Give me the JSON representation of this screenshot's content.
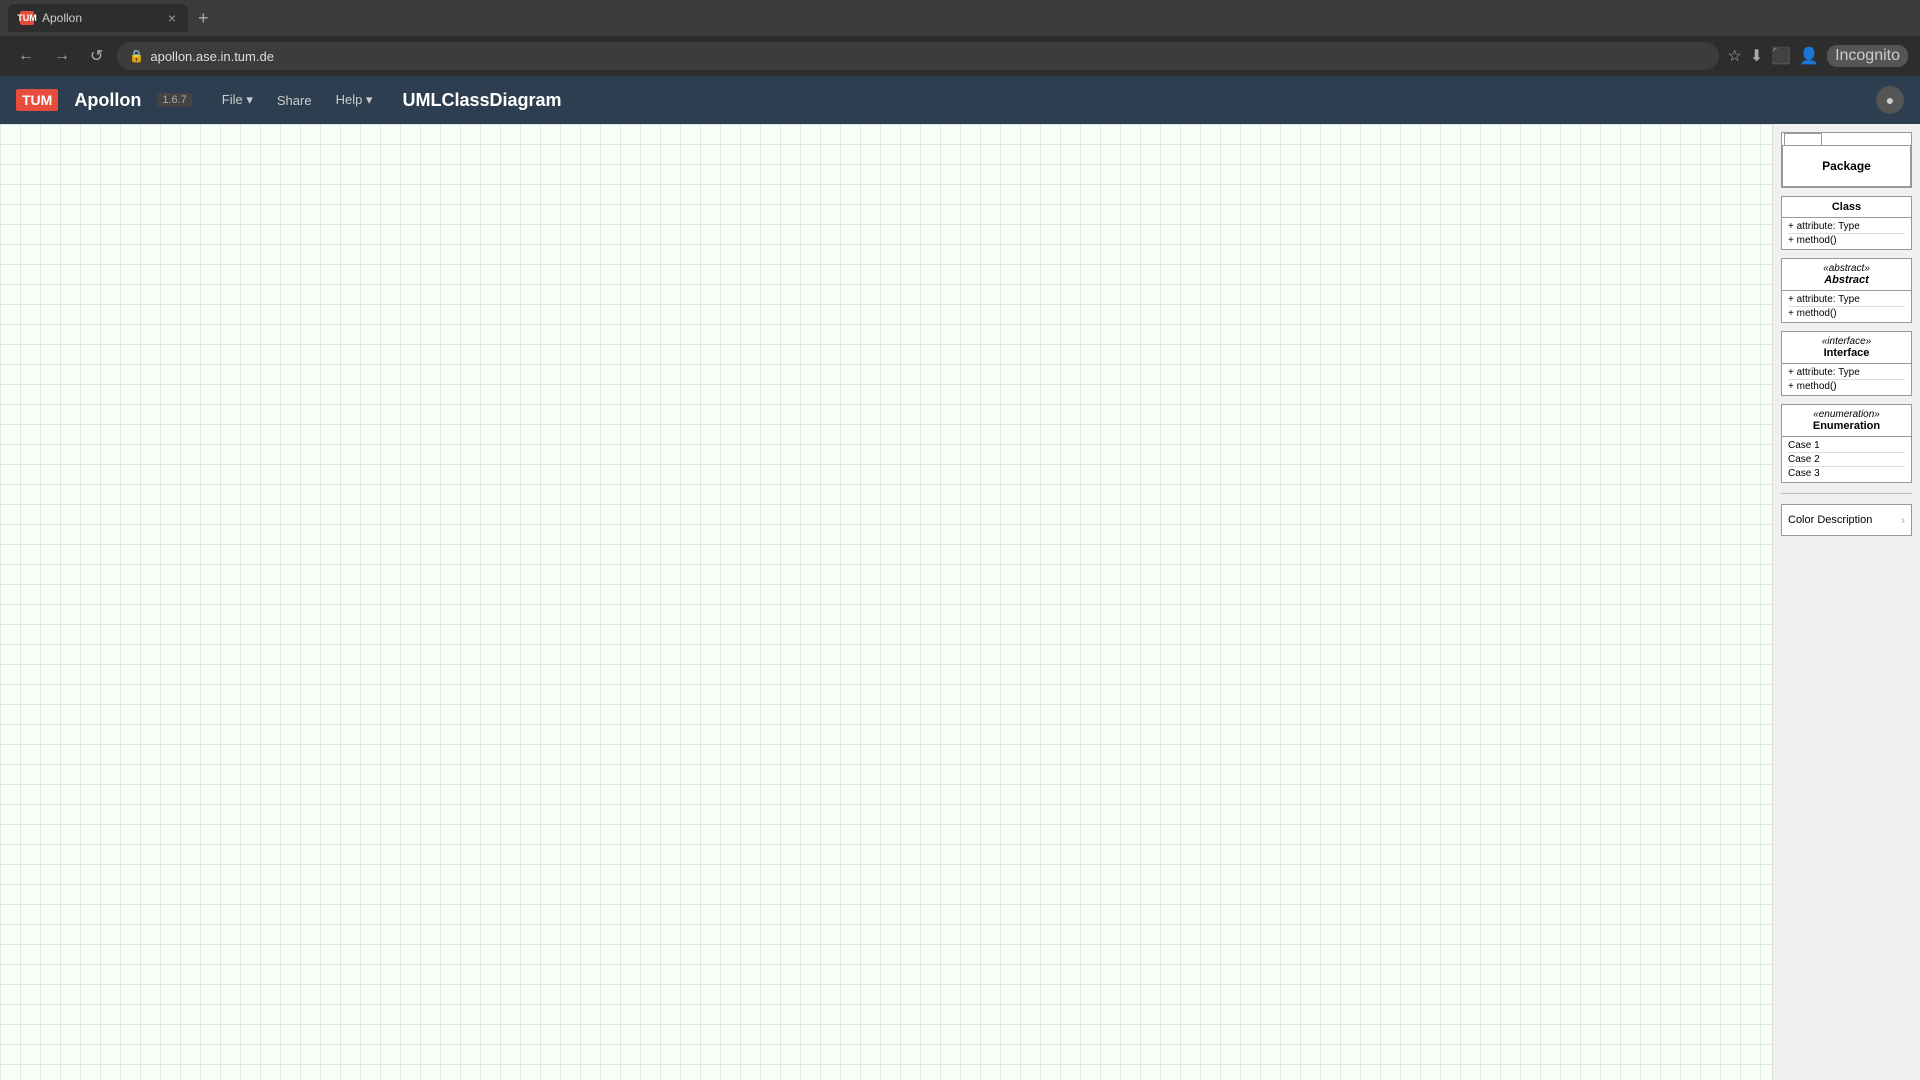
{
  "browser": {
    "tab_favicon": "TUM",
    "tab_title": "Apollon",
    "tab_close": "×",
    "tab_new": "+",
    "nav_back": "←",
    "nav_forward": "→",
    "nav_refresh": "↺",
    "address_url": "apollon.ase.in.tum.de",
    "nav_icons": [
      "☆",
      "⬇",
      "□"
    ],
    "incognito_label": "Incognito"
  },
  "header": {
    "tum_label": "TUM",
    "app_name": "Apollon",
    "version": "1.6.7",
    "menu_items": [
      {
        "label": "File",
        "has_arrow": true
      },
      {
        "label": "Share"
      },
      {
        "label": "Help",
        "has_arrow": true
      }
    ],
    "diagram_title": "UMLClassDiagram",
    "circle_icon": "○"
  },
  "sidebar": {
    "package": {
      "label": "Package"
    },
    "class": {
      "name": "Class",
      "attribute": "+ attribute: Type",
      "method": "+ method()"
    },
    "abstract": {
      "stereotype": "«abstract»",
      "name": "Abstract",
      "attribute": "+ attribute: Type",
      "method": "+ method()"
    },
    "interface": {
      "stereotype": "«interface»",
      "name": "Interface",
      "attribute": "+ attribute: Type",
      "method": "+ method()"
    },
    "enumeration": {
      "stereotype": "«enumeration»",
      "name": "Enumeration",
      "cases": [
        "Case 1",
        "Case 2",
        "Case 3"
      ]
    },
    "color_description": {
      "label": "Color Description",
      "arrow": "›"
    }
  }
}
